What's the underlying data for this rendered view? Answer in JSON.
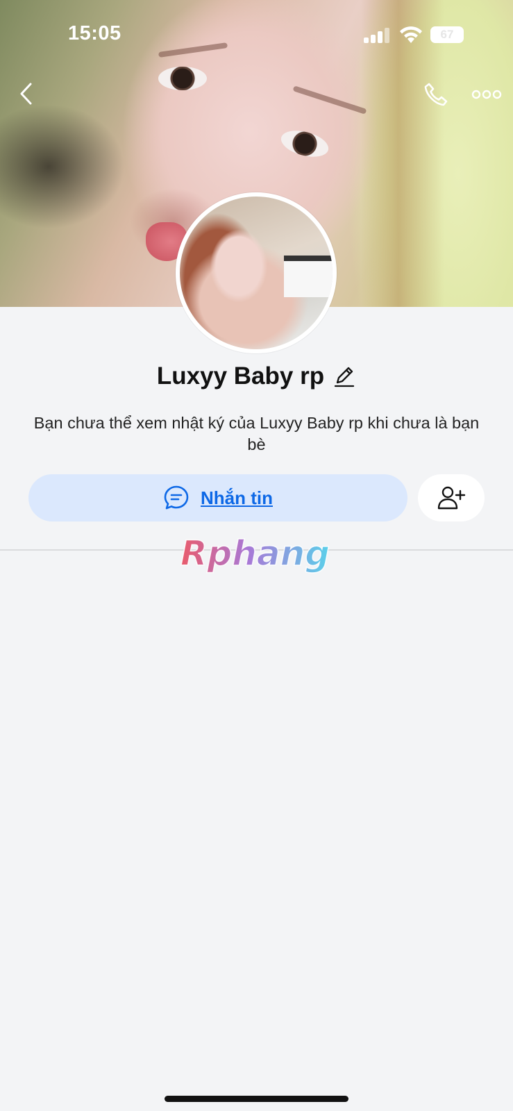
{
  "status_bar": {
    "time": "15:05",
    "battery": "67",
    "icons": [
      "cellular-signal-icon",
      "wifi-icon",
      "battery-icon"
    ]
  },
  "top_nav": {
    "icons": [
      "back-chevron-icon",
      "phone-call-icon",
      "more-dots-icon"
    ]
  },
  "profile": {
    "name": "Luxyy Baby rp",
    "notice": "Bạn chưa thể xem nhật ký của Luxyy Baby rp khi chưa là bạn bè"
  },
  "actions": {
    "message_label": "Nhắn tin",
    "message_icon": "chat-bubble-icon",
    "add_friend_icon": "add-friend-icon"
  },
  "watermark": {
    "text": "Rphang"
  },
  "colors": {
    "accent": "#0d68e6",
    "message_button_bg": "#dbe8fd",
    "page_bg": "#f3f4f6"
  }
}
